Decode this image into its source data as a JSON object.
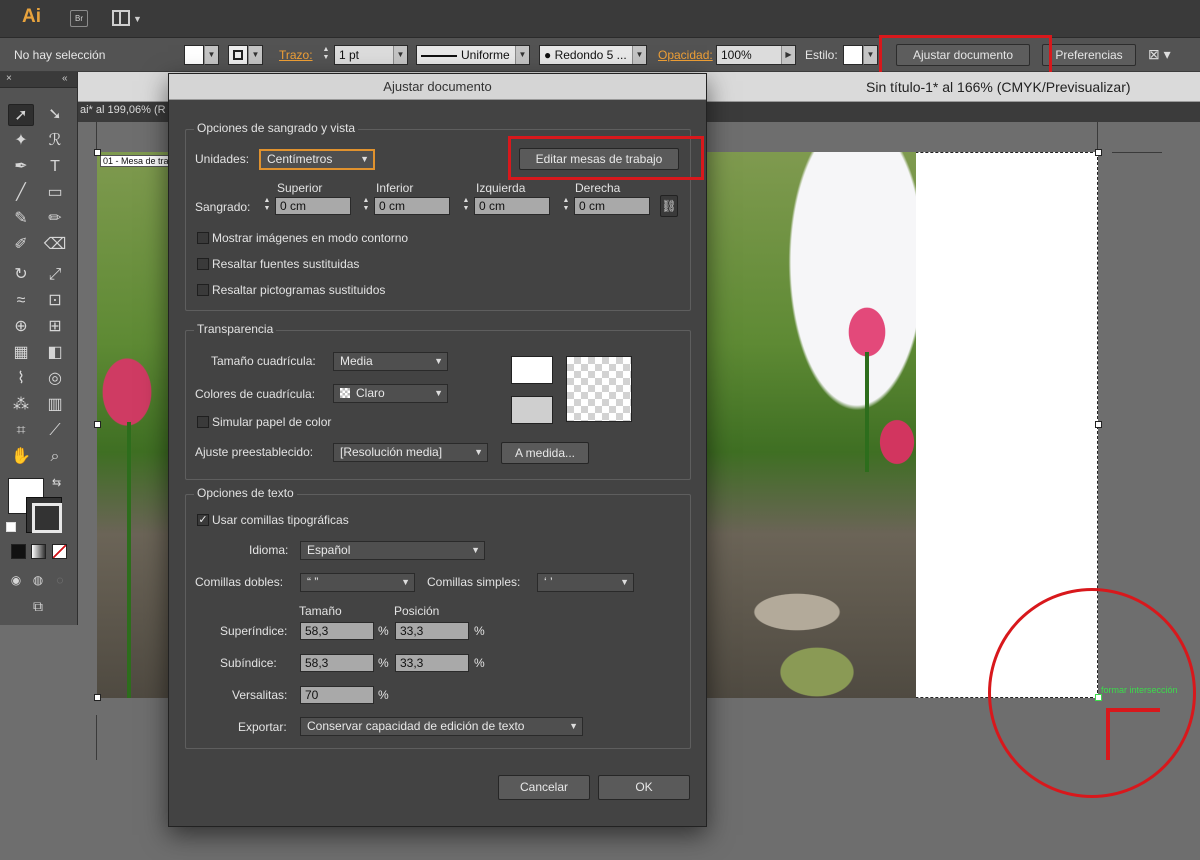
{
  "app": {
    "logo": "Ai",
    "bridge_label": "Br"
  },
  "control_bar": {
    "selection_status": "No hay selección",
    "stroke_label": "Trazo:",
    "stroke_weight": "1 pt",
    "stroke_profile": "Uniforme",
    "brush": "Redondo 5 ...",
    "opacity_label": "Opacidad:",
    "opacity_value": "100%",
    "style_label": "Estilo:",
    "document_setup_button": "Ajustar documento",
    "preferences_button": "Preferencias"
  },
  "document": {
    "tab_partial": "ai* al 199,06% (R",
    "title": "Sin título-1* al 166% (CMYK/Previsualizar)",
    "artboard_label": "01 - Mesa de tra",
    "smart_guide": "formar intersección"
  },
  "tools_panel": {
    "close_glyph": "×",
    "collapse_glyph": "«",
    "tools": [
      "selection-tool",
      "direct-selection-tool",
      "magic-wand-tool",
      "lasso-tool",
      "pen-tool",
      "type-tool",
      "line-tool",
      "rectangle-tool",
      "paintbrush-tool",
      "pencil-tool",
      "blob-brush-tool",
      "eraser-tool",
      "rotate-tool",
      "scale-tool",
      "width-tool",
      "free-transform-tool",
      "shape-builder-tool",
      "perspective-grid-tool",
      "mesh-tool",
      "gradient-tool",
      "eyedropper-tool",
      "blend-tool",
      "symbol-sprayer-tool",
      "column-graph-tool",
      "artboard-tool",
      "slice-tool",
      "hand-tool",
      "zoom-tool"
    ]
  },
  "dialog": {
    "title": "Ajustar documento",
    "bleed_section": {
      "title": "Opciones de sangrado y vista",
      "units_label": "Unidades:",
      "units_value": "Centímetros",
      "edit_artboards_button": "Editar mesas de trabajo",
      "bleed_label": "Sangrado:",
      "top_label": "Superior",
      "bottom_label": "Inferior",
      "left_label": "Izquierda",
      "right_label": "Derecha",
      "top_value": "0 cm",
      "bottom_value": "0 cm",
      "left_value": "0 cm",
      "right_value": "0 cm",
      "checkboxes": [
        {
          "label": "Mostrar imágenes en modo contorno",
          "checked": false
        },
        {
          "label": "Resaltar fuentes sustituidas",
          "checked": false
        },
        {
          "label": "Resaltar pictogramas sustituidos",
          "checked": false
        }
      ]
    },
    "transparency_section": {
      "title": "Transparencia",
      "grid_size_label": "Tamaño cuadrícula:",
      "grid_size_value": "Media",
      "grid_colors_label": "Colores de cuadrícula:",
      "grid_colors_value": "Claro",
      "simulate_paper_label": "Simular papel de color",
      "preset_label": "Ajuste preestablecido:",
      "preset_value": "[Resolución media]",
      "custom_button": "A medida..."
    },
    "text_section": {
      "title": "Opciones de texto",
      "smart_quotes_label": "Usar comillas tipográficas",
      "smart_quotes_checked": true,
      "language_label": "Idioma:",
      "language_value": "Español",
      "double_quotes_label": "Comillas dobles:",
      "double_quotes_value": "“ ”",
      "single_quotes_label": "Comillas simples:",
      "single_quotes_value": "‘ ’",
      "size_label": "Tamaño",
      "position_label": "Posición",
      "superscript_label": "Superíndice:",
      "superscript_size": "58,3",
      "superscript_position": "33,3",
      "subscript_label": "Subíndice:",
      "subscript_size": "58,3",
      "subscript_position": "33,3",
      "small_caps_label": "Versalitas:",
      "small_caps_value": "70",
      "percent": "%",
      "export_label": "Exportar:",
      "export_value": "Conservar capacidad de edición de texto"
    },
    "cancel_button": "Cancelar",
    "ok_button": "OK"
  },
  "colors": {
    "highlight": "#d8181c",
    "orange_label": "#f0a036",
    "smart_guide": "#3bdc4b"
  }
}
